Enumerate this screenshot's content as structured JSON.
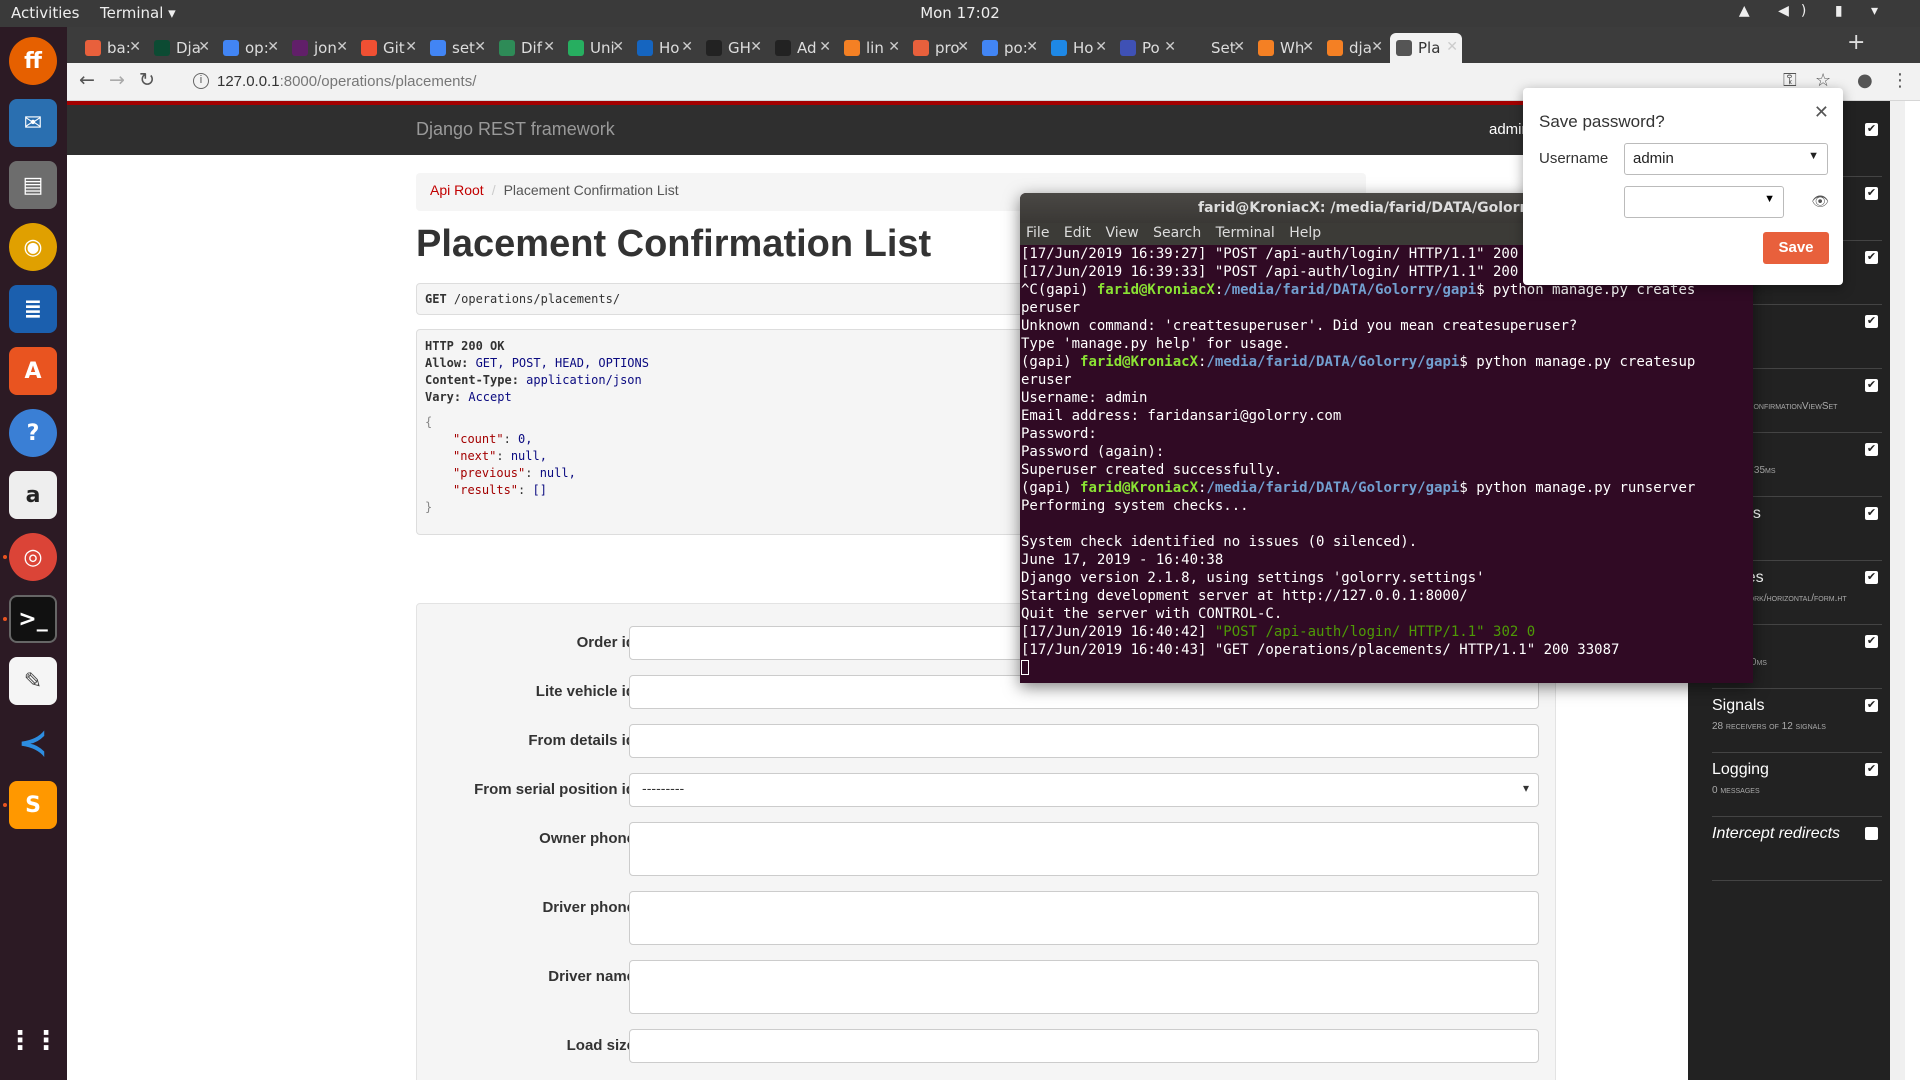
{
  "system": {
    "activities": "Activities",
    "app": "Terminal ▾",
    "clock": "Mon 17:02",
    "tray": "▲ ◀) ▮ ▾"
  },
  "tabs": [
    {
      "label": "ba:",
      "color": "#e8603c"
    },
    {
      "label": "Dja",
      "color": "#0c4b33"
    },
    {
      "label": "op:",
      "color": "#4285f4"
    },
    {
      "label": "jon",
      "color": "#611f69"
    },
    {
      "label": "Git",
      "color": "#f05033"
    },
    {
      "label": "set",
      "color": "#4285f4"
    },
    {
      "label": "Dif",
      "color": "#2e8b57"
    },
    {
      "label": "Uni",
      "color": "#27ae60"
    },
    {
      "label": "Ho",
      "color": "#1565c0"
    },
    {
      "label": "GH",
      "color": "#222222"
    },
    {
      "label": "Ad",
      "color": "#222222"
    },
    {
      "label": "lin",
      "color": "#f48024"
    },
    {
      "label": "pro",
      "color": "#e8603c"
    },
    {
      "label": "po:",
      "color": "#4285f4"
    },
    {
      "label": "Ho",
      "color": "#1e88e5"
    },
    {
      "label": "Po",
      "color": "#3f51b5"
    },
    {
      "label": "Set",
      "color": "#3c3c3c"
    },
    {
      "label": "Wh",
      "color": "#f48024"
    },
    {
      "label": "dja",
      "color": "#f48024"
    },
    {
      "label": "Pla",
      "color": "#555555"
    }
  ],
  "url": {
    "host": "127.0.0.1",
    "path": ":8000/operations/placements/"
  },
  "drf": {
    "brand": "Django REST framework",
    "user": "admin"
  },
  "breadcrumb": {
    "root": "Api Root",
    "current": "Placement Confirmation List"
  },
  "page_title": "Placement Confirmation List",
  "request": {
    "method": "GET",
    "path": " /operations/placements/"
  },
  "response": {
    "status": "HTTP 200 OK",
    "headers": [
      {
        "k": "Allow:",
        "v": " GET, POST, HEAD, OPTIONS"
      },
      {
        "k": "Content-Type:",
        "v": " application/json"
      },
      {
        "k": "Vary:",
        "v": " Accept"
      }
    ],
    "open": "{",
    "body": [
      {
        "k": "\"count\"",
        "v": "0,"
      },
      {
        "k": "\"next\"",
        "v": "null,"
      },
      {
        "k": "\"previous\"",
        "v": "null,"
      },
      {
        "k": "\"results\"",
        "v": "[]"
      }
    ],
    "close": "}"
  },
  "form": {
    "fields": [
      {
        "label": "Order id",
        "value": ""
      },
      {
        "label": "Lite vehicle id",
        "value": ""
      },
      {
        "label": "From details id",
        "value": ""
      },
      {
        "label": "From serial position id",
        "value": "---------"
      },
      {
        "label": "Owner phone",
        "value": ""
      },
      {
        "label": "Driver phone",
        "value": ""
      },
      {
        "label": "Driver name",
        "value": ""
      },
      {
        "label": "Load size",
        "value": ""
      }
    ]
  },
  "ddt": {
    "items": [
      {
        "title": "",
        "sub": ""
      },
      {
        "title": "",
        "sub": "41ms)"
      },
      {
        "title": "tings",
        "sub": ""
      },
      {
        "title": "aders",
        "sub": ""
      },
      {
        "title": "quest",
        "sub": "acementConfirmationViewSet"
      },
      {
        "title": "L",
        "sub": "eries in 1.35ms"
      },
      {
        "title": "tic files",
        "sub": "les used"
      },
      {
        "title": "nplates",
        "sub": "_framework/horizontal/form.ht"
      },
      {
        "title": "che",
        "sub": "lls in 0.00ms"
      },
      {
        "title": "Signals",
        "sub": "28 receivers of 12 signals"
      },
      {
        "title": "Logging",
        "sub": "0 messages"
      },
      {
        "title": "Intercept redirects",
        "sub": ""
      }
    ]
  },
  "terminal": {
    "title": "farid@KroniacX: /media/farid/DATA/Golorry/gapi",
    "menu": "File Edit View Search Terminal Help",
    "lines": [
      {
        "t": "[17/Jun/2019 16:39:27] \"POST /api-auth/login/ HTTP/1.1\" 200 3105"
      },
      {
        "t": "[17/Jun/2019 16:39:33] \"POST /api-auth/login/ HTTP/1.1\" 200 3105"
      },
      {
        "p": "^C(gapi) ",
        "u": "farid@KroniacX",
        "c": ":",
        "d": "/media/farid/DATA/Golorry/gapi",
        "t": "$ python manage.py creates"
      },
      {
        "t": "peruser"
      },
      {
        "t": "Unknown command: 'creattesuperuser'. Did you mean createsuperuser?"
      },
      {
        "t": "Type 'manage.py help' for usage."
      },
      {
        "p": "(gapi) ",
        "u": "farid@KroniacX",
        "c": ":",
        "d": "/media/farid/DATA/Golorry/gapi",
        "t": "$ python manage.py createsup"
      },
      {
        "t": "eruser"
      },
      {
        "t": "Username: admin"
      },
      {
        "t": "Email address: faridansari@golorry.com"
      },
      {
        "t": "Password:"
      },
      {
        "t": "Password (again):"
      },
      {
        "t": "Superuser created successfully."
      },
      {
        "p": "(gapi) ",
        "u": "farid@KroniacX",
        "c": ":",
        "d": "/media/farid/DATA/Golorry/gapi",
        "t": "$ python manage.py runserver"
      },
      {
        "t": "Performing system checks..."
      },
      {
        "t": " "
      },
      {
        "t": "System check identified no issues (0 silenced)."
      },
      {
        "t": "June 17, 2019 - 16:40:38"
      },
      {
        "t": "Django version 2.1.8, using settings 'golorry.settings'"
      },
      {
        "t": "Starting development server at http://127.0.0.1:8000/"
      },
      {
        "t": "Quit the server with CONTROL-C."
      },
      {
        "t": "[17/Jun/2019 16:40:42] ",
        "g": "\"POST /api-auth/login/ HTTP/1.1\" 302 0"
      },
      {
        "t": "[17/Jun/2019 16:40:43] \"GET /operations/placements/ HTTP/1.1\" 200 33087"
      }
    ]
  },
  "password_dialog": {
    "title": "Save password?",
    "username_label": "Username",
    "username": "admin",
    "save": "Save"
  }
}
